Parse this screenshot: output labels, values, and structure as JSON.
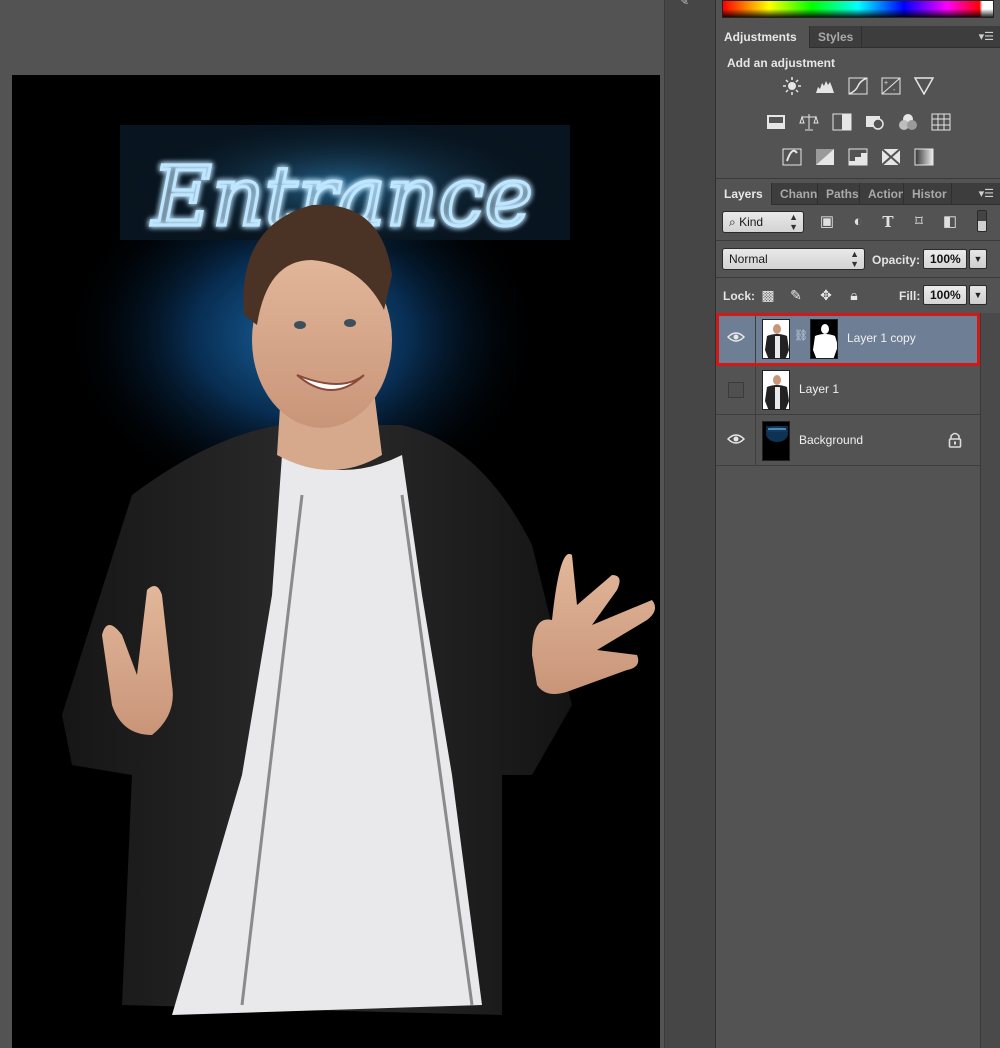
{
  "adjustments_panel": {
    "tabs": [
      "Adjustments",
      "Styles"
    ],
    "title": "Add an adjustment",
    "icons_row1": [
      "brightness-contrast-icon",
      "levels-icon",
      "curves-icon",
      "exposure-icon",
      "vibrance-icon"
    ],
    "icons_row2": [
      "hue-saturation-icon",
      "color-balance-icon",
      "black-white-icon",
      "photo-filter-icon",
      "channel-mixer-icon",
      "color-lookup-icon"
    ],
    "icons_row3": [
      "invert-icon",
      "posterize-icon",
      "threshold-icon",
      "selective-color-icon",
      "gradient-map-icon"
    ]
  },
  "layers_panel": {
    "tabs": [
      "Layers",
      "Chann",
      "Paths",
      "Action",
      "Histor"
    ],
    "filter": {
      "label": "Kind"
    },
    "blend_mode": "Normal",
    "opacity_label": "Opacity:",
    "opacity_value": "100%",
    "lock_label": "Lock:",
    "fill_label": "Fill:",
    "fill_value": "100%",
    "layers": [
      {
        "name": "Layer 1 copy",
        "visible": true,
        "selected": true,
        "has_mask": true
      },
      {
        "name": "Layer 1",
        "visible": false,
        "selected": false,
        "has_mask": false
      },
      {
        "name": "Background",
        "visible": true,
        "selected": false,
        "locked": true
      }
    ]
  },
  "document": {
    "neon_sign_text": "Entrance"
  },
  "colors": {
    "selection_outline": "#d01a1a",
    "selected_row": "#6e7e95",
    "panel_bg": "#535353"
  }
}
